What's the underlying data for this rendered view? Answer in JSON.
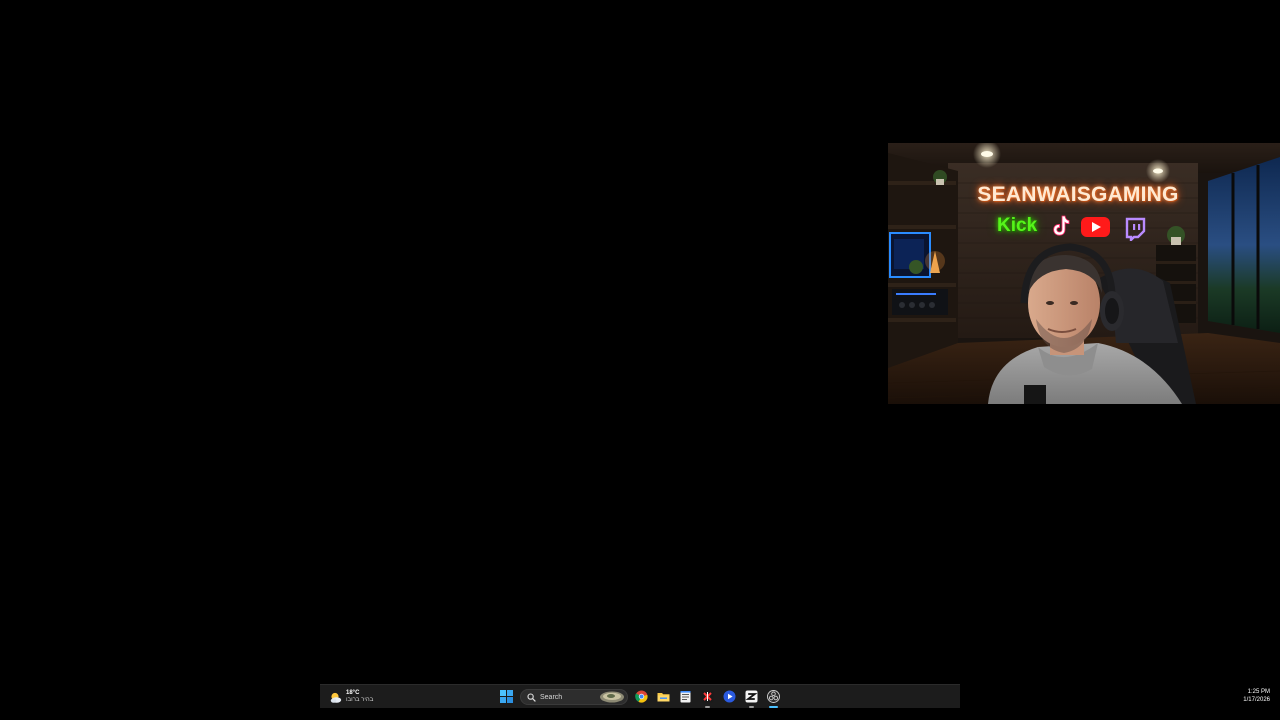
{
  "webcam": {
    "brand_title": "SEANWAISGAMING",
    "kick_label": "Kick",
    "icons": [
      "tiktok-icon",
      "youtube-icon",
      "twitch-icon"
    ],
    "colors": {
      "brand_glow": "#ff7a2a",
      "kick_green": "#56f51a",
      "youtube_red": "#ff1a1a",
      "twitch_purple": "#9146ff"
    }
  },
  "taskbar": {
    "weather": {
      "icon": "partly-cloudy-icon",
      "temperature": "18°C",
      "condition": "בהיר ברובו"
    },
    "start_icon": "windows-start-icon",
    "search": {
      "icon": "search-icon",
      "placeholder": "Search"
    },
    "pinned_apps": [
      {
        "name": "chrome-icon",
        "active": false
      },
      {
        "name": "file-explorer-icon",
        "active": false
      },
      {
        "name": "notepad-icon",
        "active": false
      },
      {
        "name": "capcut-icon",
        "active": true
      },
      {
        "name": "media-player-icon",
        "active": false
      },
      {
        "name": "capcut-editor-icon",
        "active": true
      },
      {
        "name": "obs-studio-icon",
        "active": true
      }
    ],
    "accent_color": "#4cc2ff"
  },
  "clock": {
    "time": "1:25 PM",
    "date": "1/17/2026"
  }
}
